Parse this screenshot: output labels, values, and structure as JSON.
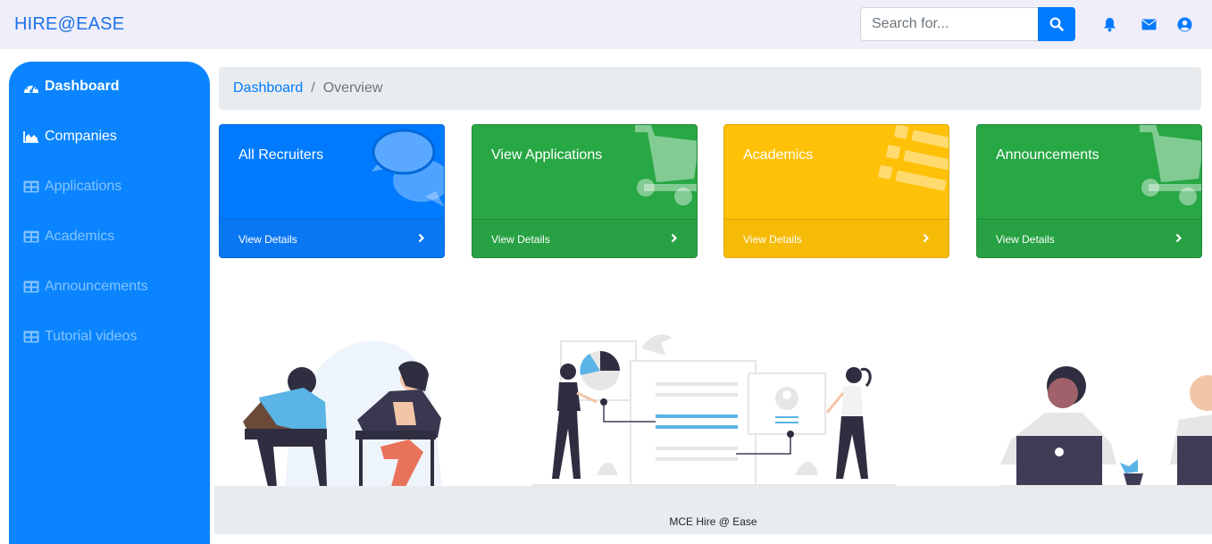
{
  "header": {
    "brand": "HIRE@EASE",
    "search_placeholder": "Search for...",
    "icons": [
      "search-icon",
      "bell-icon",
      "envelope-icon",
      "user-circle-icon"
    ]
  },
  "sidebar": {
    "items": [
      {
        "label": "Dashboard",
        "icon": "tachometer-icon"
      },
      {
        "label": "Companies",
        "icon": "area-chart-icon"
      },
      {
        "label": "Applications",
        "icon": "table-icon"
      },
      {
        "label": "Academics",
        "icon": "table-icon"
      },
      {
        "label": "Announcements",
        "icon": "table-icon"
      },
      {
        "label": "Tutorial videos",
        "icon": "table-icon"
      }
    ]
  },
  "breadcrumb": {
    "parent": "Dashboard",
    "separator": "/",
    "current": "Overview"
  },
  "cards": [
    {
      "title": "All Recruiters",
      "footer": "View Details",
      "color": "#007bff",
      "icon": "comments-icon"
    },
    {
      "title": "View Applications",
      "footer": "View Details",
      "color": "#28a745",
      "icon": "shopping-cart-icon"
    },
    {
      "title": "Academics",
      "footer": "View Details",
      "color": "#ffc107",
      "icon": "list-icon"
    },
    {
      "title": "Announcements",
      "footer": "View Details",
      "color": "#28a745",
      "icon": "shopping-cart-icon"
    }
  ],
  "footer": {
    "text": "MCE Hire @ Ease"
  },
  "colors": {
    "brand": "#1a73e8",
    "sidebar": "#0a85ff",
    "primary": "#007bff",
    "success": "#28a745",
    "warning": "#ffc107"
  }
}
